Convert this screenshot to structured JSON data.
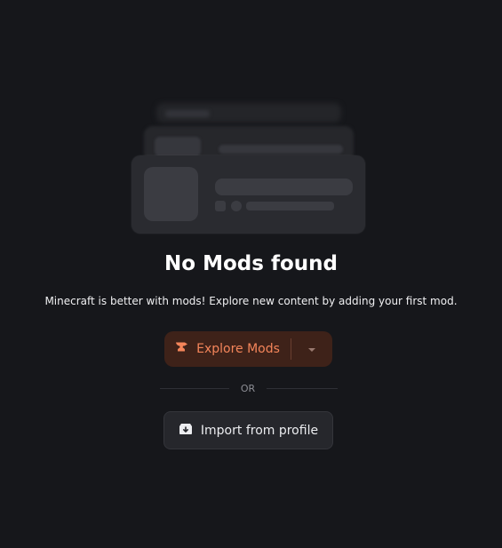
{
  "empty_state": {
    "title": "No Mods found",
    "message": "Minecraft is better with mods! Explore new content by adding your first mod.",
    "separator_text": "OR"
  },
  "actions": {
    "explore": {
      "label": "Explore Mods",
      "icon": "hammer-icon",
      "dropdown_icon": "caret-down-icon"
    },
    "import": {
      "label": "Import from profile",
      "icon": "import-box-icon"
    }
  },
  "colors": {
    "background": "#16171b",
    "accent": "#f4855a",
    "accent_bg": "#3e2219",
    "secondary_button_bg": "#26272c",
    "placeholder": "#2a2b30"
  }
}
